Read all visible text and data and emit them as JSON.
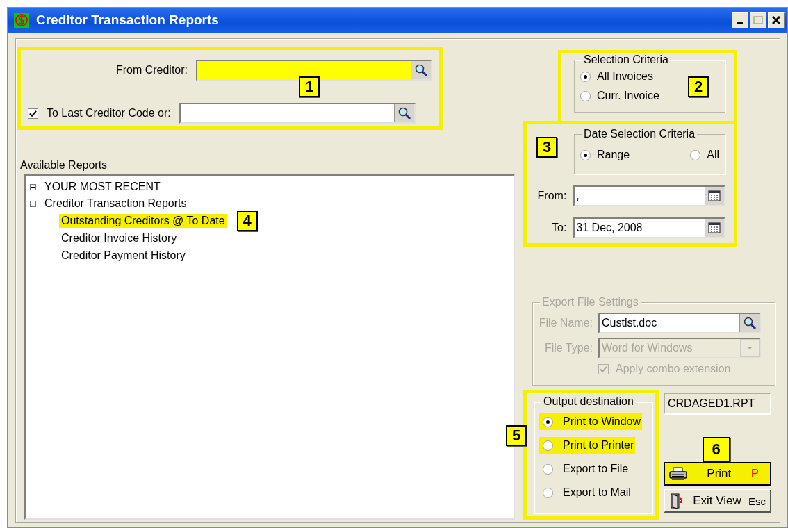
{
  "window": {
    "title": "Creditor Transaction Reports"
  },
  "creditor_range": {
    "from_label": "From Creditor:",
    "from_highlighted": true,
    "to_label": "To Last Creditor Code or:",
    "to_checked": true
  },
  "available_reports": {
    "label": "Available Reports",
    "tree": [
      {
        "label": "YOUR MOST RECENT",
        "expanded": false,
        "selected": false
      },
      {
        "label": "Creditor Transaction Reports",
        "expanded": true,
        "selected": false,
        "children": [
          {
            "label": "Outstanding Creditors @ To Date",
            "selected": true
          },
          {
            "label": "Creditor Invoice History",
            "selected": false
          },
          {
            "label": "Creditor Payment History",
            "selected": false
          }
        ]
      }
    ]
  },
  "selection_criteria": {
    "title": "Selection Criteria",
    "options": [
      {
        "label": "All Invoices",
        "selected": true
      },
      {
        "label": "Curr. Invoice",
        "selected": false
      }
    ]
  },
  "date_selection": {
    "title": "Date Selection Criteria",
    "options": [
      {
        "label": "Range",
        "selected": true
      },
      {
        "label": "All",
        "selected": false
      }
    ],
    "from_label": "From:",
    "from_value": ",",
    "to_label": "To:",
    "to_value": "31 Dec, 2008"
  },
  "export_settings": {
    "title": "Export  File Settings",
    "disabled": true,
    "file_name_label": "File Name:",
    "file_name": "Custlst.doc",
    "file_type_label": "File Type:",
    "file_type": "Word for Windows",
    "apply_combo_label": "Apply combo extension",
    "apply_combo_checked": true
  },
  "output_destination": {
    "title": "Output destination",
    "options": [
      {
        "label": "Print to Window",
        "selected": true,
        "highlighted": true
      },
      {
        "label": "Print to Printer",
        "selected": false,
        "highlighted": true
      },
      {
        "label": "Export to File",
        "selected": false,
        "highlighted": false
      },
      {
        "label": "Export to Mail",
        "selected": false,
        "highlighted": false
      }
    ]
  },
  "report_file": "CRDAGED1.RPT",
  "buttons": [
    {
      "kind": "print",
      "label": "Print",
      "shortcut": "P",
      "highlighted": true
    },
    {
      "kind": "exit",
      "label": "Exit View",
      "shortcut": "Esc",
      "highlighted": false
    }
  ],
  "callouts": [
    "1",
    "2",
    "3",
    "4",
    "5",
    "6"
  ]
}
